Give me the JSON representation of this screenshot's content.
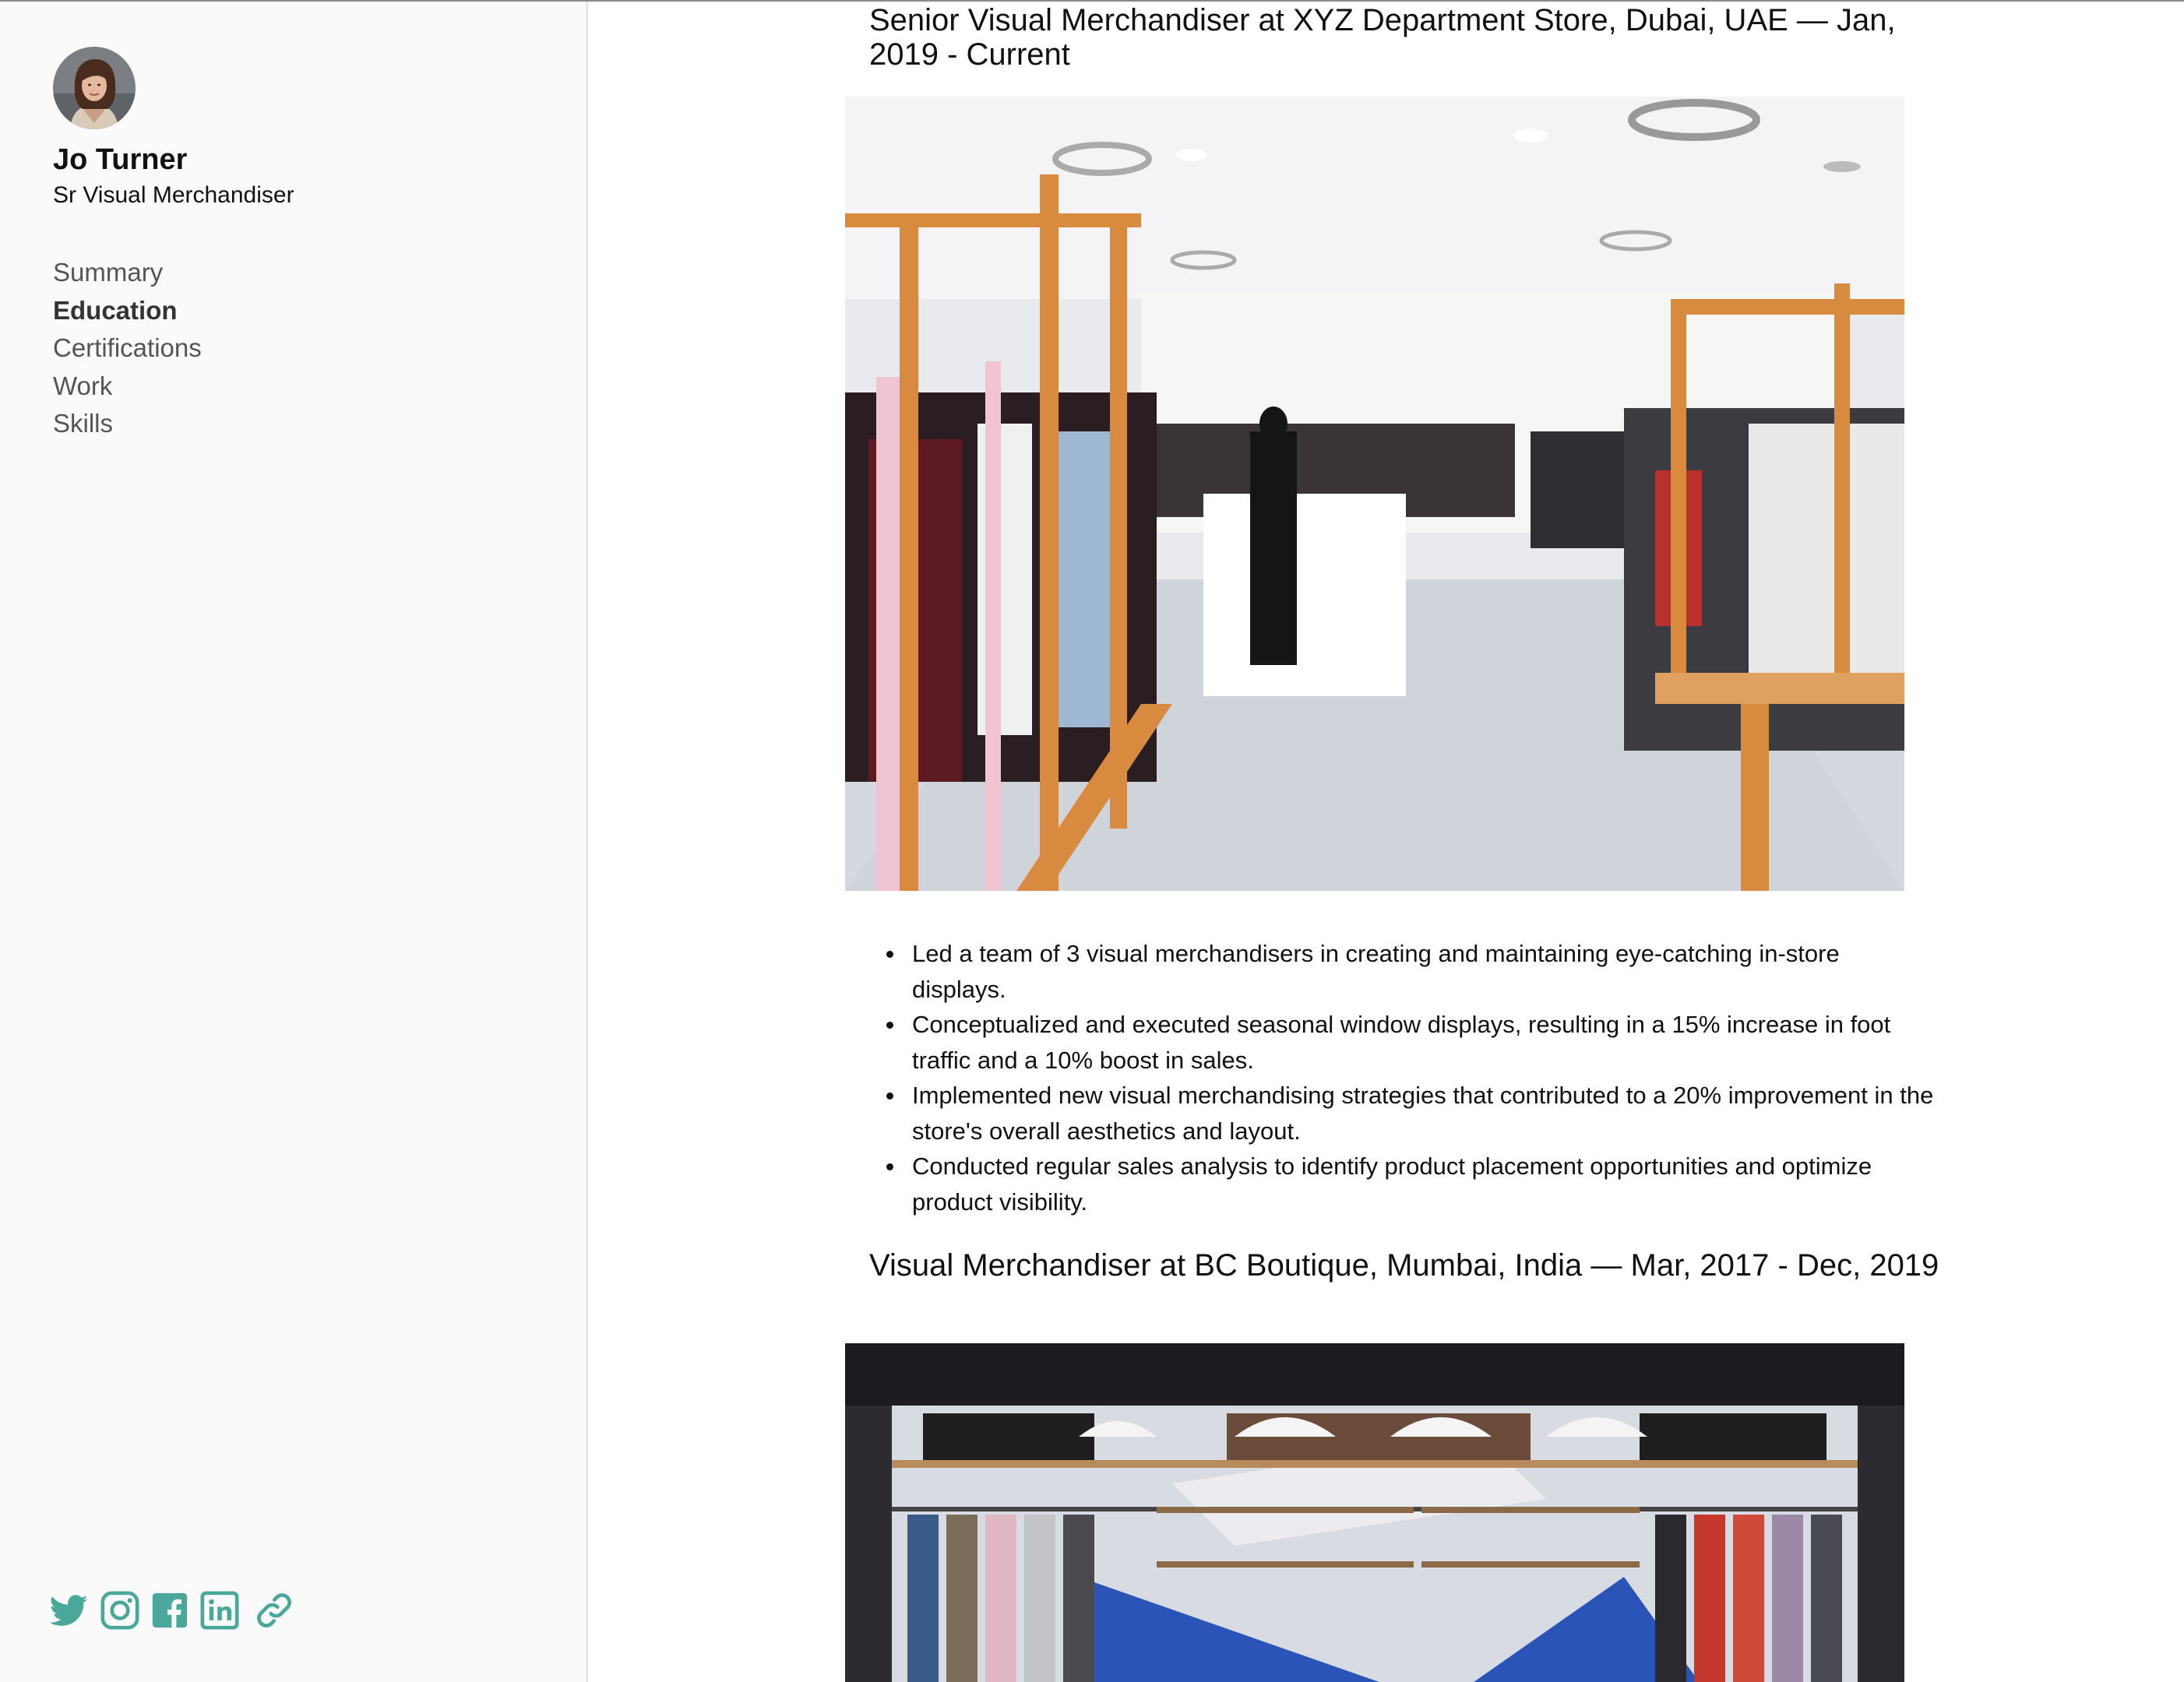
{
  "profile": {
    "name": "Jo Turner",
    "role": "Sr Visual Merchandiser"
  },
  "nav": {
    "items": [
      {
        "label": "Summary",
        "active": false
      },
      {
        "label": "Education",
        "active": true
      },
      {
        "label": "Certifications",
        "active": false
      },
      {
        "label": "Work",
        "active": false
      },
      {
        "label": "Skills",
        "active": false
      }
    ]
  },
  "social": {
    "color": "#4aa89a",
    "icons": [
      "twitter-icon",
      "instagram-icon",
      "facebook-icon",
      "linkedin-icon",
      "link-icon"
    ]
  },
  "work": [
    {
      "title": "Senior Visual Merchandiser at XYZ Department Store, Dubai, UAE — Jan, 2019 - Current",
      "bullets": [
        "Led a team of 3 visual merchandisers in creating and maintaining eye-catching in-store displays.",
        "Conceptualized and executed seasonal window displays, resulting in a 15% increase in foot traffic and a 10% boost in sales.",
        "Implemented new visual merchandising strategies that contributed to a 20% improvement in the store's overall aesthetics and layout.",
        "Conducted regular sales analysis to identify product placement opportunities and optimize product visibility."
      ]
    },
    {
      "title": "Visual Merchandiser at BC Boutique, Mumbai, India — Mar, 2017 - Dec, 2019",
      "bullets": []
    }
  ]
}
